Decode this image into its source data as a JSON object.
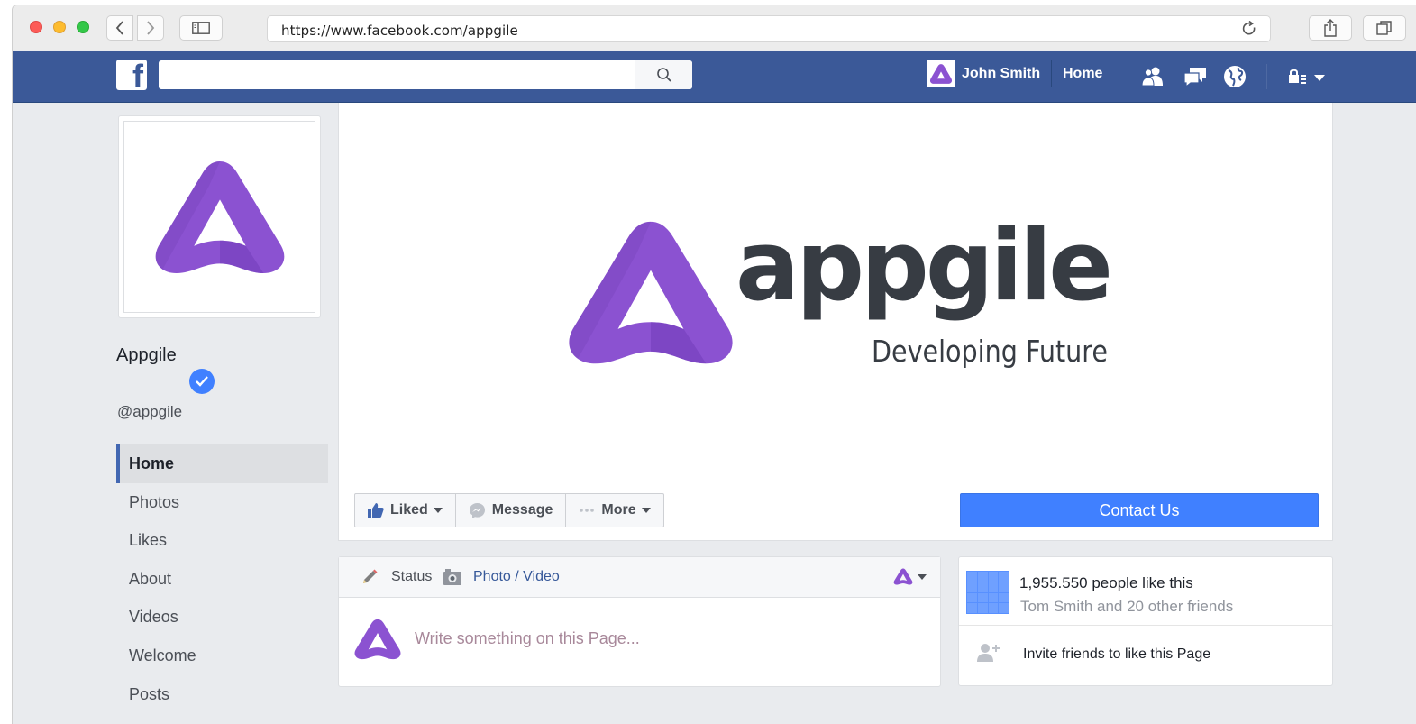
{
  "browser": {
    "url": "https://www.facebook.com/appgile"
  },
  "fb_header": {
    "search_placeholder": "",
    "user_name": "John Smith",
    "home_label": "Home"
  },
  "page": {
    "name": "Appgile",
    "handle": "@appgile",
    "cover": {
      "brand": "appgile",
      "tagline": "Developing Future"
    }
  },
  "left_nav": {
    "items": [
      {
        "label": "Home",
        "active": true
      },
      {
        "label": "Photos"
      },
      {
        "label": "Likes"
      },
      {
        "label": "About"
      },
      {
        "label": "Videos"
      },
      {
        "label": "Welcome"
      },
      {
        "label": "Posts"
      }
    ]
  },
  "actions": {
    "liked": "Liked",
    "message": "Message",
    "more": "More",
    "contact": "Contact Us"
  },
  "composer": {
    "status_tab": "Status",
    "photo_tab": "Photo / Video",
    "placeholder": "Write something on this Page..."
  },
  "likes_box": {
    "count_text": "1,955.550 people like this",
    "friends_text": "Tom Smith and 20 other friends",
    "invite_text": "Invite friends to like this Page"
  },
  "colors": {
    "fb_blue": "#3b5998",
    "brand_purple": "#8b52d1",
    "contact_blue": "#4080ff"
  },
  "icons": [
    "search-icon",
    "friends-icon",
    "messages-icon",
    "globe-icon",
    "privacy-icon",
    "thumbs-up-icon",
    "messenger-icon",
    "ellipsis-icon",
    "pencil-icon",
    "camera-icon",
    "add-friend-icon",
    "verified-icon"
  ]
}
